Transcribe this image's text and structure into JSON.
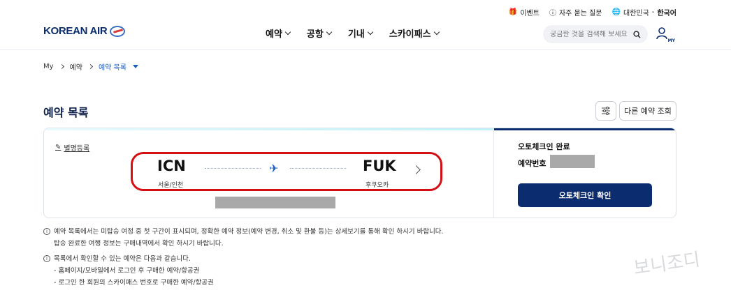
{
  "header": {
    "util": {
      "event": "이벤트",
      "faq": "자주 묻는 질문",
      "region_country": "대한민국",
      "region_sep": "-",
      "region_lang": "한국어"
    },
    "logo_text": "KOREAN AIR",
    "nav": [
      "예약",
      "공항",
      "기내",
      "스카이패스"
    ],
    "search": {
      "placeholder": "궁금한 것을 검색해 보세요"
    },
    "my_label": "MY"
  },
  "breadcrumb": {
    "items": [
      "My",
      "예약"
    ],
    "current": "예약 목록"
  },
  "page": {
    "title": "예약 목록",
    "other_lookup_label": "다른 예약 조회"
  },
  "reservation": {
    "alias_label": "별명등록",
    "origin": {
      "code": "ICN",
      "city": "서울/인천"
    },
    "destination": {
      "code": "FUK",
      "city": "후쿠오카"
    },
    "status": "오토체크인 완료",
    "pnr_label": "예약번호",
    "checkin_button": "오토체크인 확인"
  },
  "notes": [
    {
      "lines": [
        "예약 목록에서는 미탑승 여정 중 첫 구간이 표시되며, 정확한 예약 정보(예약 변경, 취소 및 환불 등)는 상세보기를 통해 확인 하시기 바랍니다.",
        "탑승 완료한 여행 정보는 구매내역에서 확인 하시기 바랍니다."
      ]
    },
    {
      "lines": [
        "목록에서 확인할 수 있는 예약은 다음과 같습니다.",
        "- 홈페이지/모바일에서 로그인 후 구매한 예약/항공권",
        "- 로그인 한 회원의 스카이패스 번호로 구매한 예약/항공권"
      ]
    }
  ],
  "colors": {
    "brand_navy": "#0b2c6e",
    "link_blue": "#1b5fc0",
    "highlight_red": "#d40f14"
  }
}
